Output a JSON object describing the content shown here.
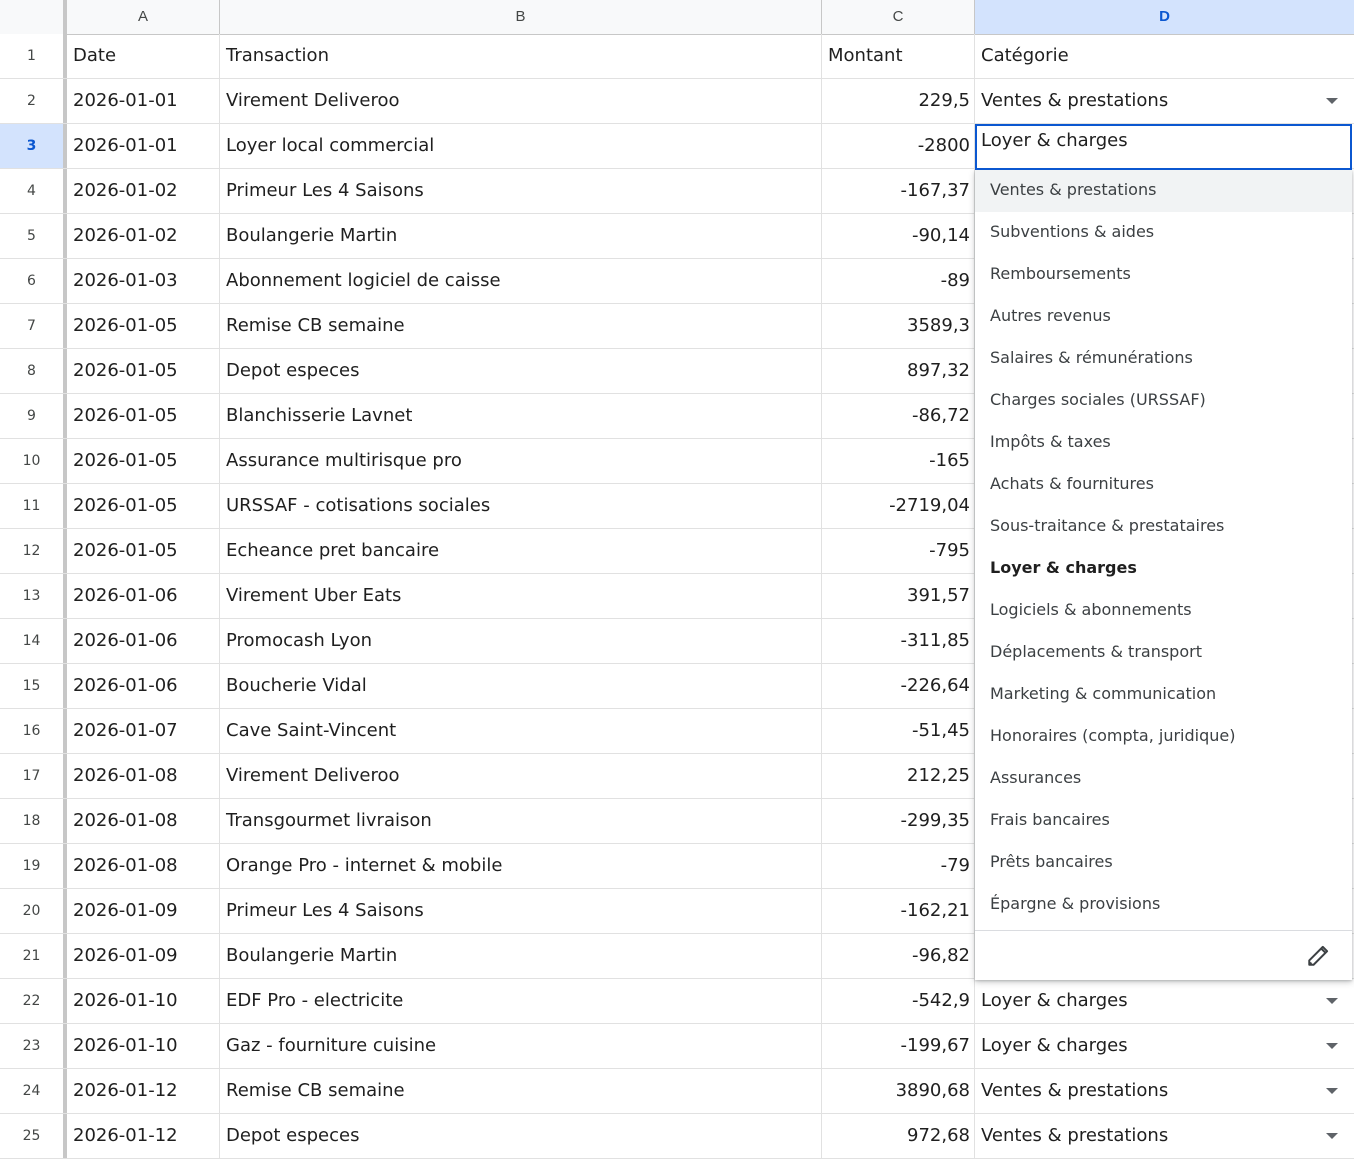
{
  "columns": [
    "A",
    "B",
    "C",
    "D"
  ],
  "selected_column": "D",
  "selected_row": "3",
  "header": {
    "date": "Date",
    "transaction": "Transaction",
    "montant": "Montant",
    "categorie": "Catégorie"
  },
  "rows": [
    {
      "n": "2",
      "date": "2026-01-01",
      "tx": "Virement Deliveroo",
      "amt": "229,5",
      "cat": "Ventes & prestations"
    },
    {
      "n": "3",
      "date": "2026-01-01",
      "tx": "Loyer local commercial",
      "amt": "-2800",
      "cat": ""
    },
    {
      "n": "4",
      "date": "2026-01-02",
      "tx": "Primeur Les 4 Saisons",
      "amt": "-167,37",
      "cat": ""
    },
    {
      "n": "5",
      "date": "2026-01-02",
      "tx": "Boulangerie Martin",
      "amt": "-90,14",
      "cat": ""
    },
    {
      "n": "6",
      "date": "2026-01-03",
      "tx": "Abonnement logiciel de caisse",
      "amt": "-89",
      "cat": ""
    },
    {
      "n": "7",
      "date": "2026-01-05",
      "tx": "Remise CB semaine",
      "amt": "3589,3",
      "cat": ""
    },
    {
      "n": "8",
      "date": "2026-01-05",
      "tx": "Depot especes",
      "amt": "897,32",
      "cat": ""
    },
    {
      "n": "9",
      "date": "2026-01-05",
      "tx": "Blanchisserie Lavnet",
      "amt": "-86,72",
      "cat": ""
    },
    {
      "n": "10",
      "date": "2026-01-05",
      "tx": "Assurance multirisque pro",
      "amt": "-165",
      "cat": ""
    },
    {
      "n": "11",
      "date": "2026-01-05",
      "tx": "URSSAF - cotisations sociales",
      "amt": "-2719,04",
      "cat": ""
    },
    {
      "n": "12",
      "date": "2026-01-05",
      "tx": "Echeance pret bancaire",
      "amt": "-795",
      "cat": ""
    },
    {
      "n": "13",
      "date": "2026-01-06",
      "tx": "Virement Uber Eats",
      "amt": "391,57",
      "cat": ""
    },
    {
      "n": "14",
      "date": "2026-01-06",
      "tx": "Promocash Lyon",
      "amt": "-311,85",
      "cat": ""
    },
    {
      "n": "15",
      "date": "2026-01-06",
      "tx": "Boucherie Vidal",
      "amt": "-226,64",
      "cat": ""
    },
    {
      "n": "16",
      "date": "2026-01-07",
      "tx": "Cave Saint-Vincent",
      "amt": "-51,45",
      "cat": ""
    },
    {
      "n": "17",
      "date": "2026-01-08",
      "tx": "Virement Deliveroo",
      "amt": "212,25",
      "cat": ""
    },
    {
      "n": "18",
      "date": "2026-01-08",
      "tx": "Transgourmet livraison",
      "amt": "-299,35",
      "cat": ""
    },
    {
      "n": "19",
      "date": "2026-01-08",
      "tx": "Orange Pro - internet & mobile",
      "amt": "-79",
      "cat": ""
    },
    {
      "n": "20",
      "date": "2026-01-09",
      "tx": "Primeur Les 4 Saisons",
      "amt": "-162,21",
      "cat": ""
    },
    {
      "n": "21",
      "date": "2026-01-09",
      "tx": "Boulangerie Martin",
      "amt": "-96,82",
      "cat": ""
    },
    {
      "n": "22",
      "date": "2026-01-10",
      "tx": "EDF Pro - electricite",
      "amt": "-542,9",
      "cat": "Loyer & charges"
    },
    {
      "n": "23",
      "date": "2026-01-10",
      "tx": "Gaz - fourniture cuisine",
      "amt": "-199,67",
      "cat": "Loyer & charges"
    },
    {
      "n": "24",
      "date": "2026-01-12",
      "tx": "Remise CB semaine",
      "amt": "3890,68",
      "cat": "Ventes & prestations"
    },
    {
      "n": "25",
      "date": "2026-01-12",
      "tx": "Depot especes",
      "amt": "972,68",
      "cat": "Ventes & prestations"
    }
  ],
  "editor": {
    "value": "Loyer & charges"
  },
  "dropdown": {
    "options": [
      "Ventes & prestations",
      "Subventions & aides",
      "Remboursements",
      "Autres revenus",
      "Salaires & rémunérations",
      "Charges sociales (URSSAF)",
      "Impôts & taxes",
      "Achats & fournitures",
      "Sous-traitance & prestataires",
      "Loyer & charges",
      "Logiciels & abonnements",
      "Déplacements & transport",
      "Marketing & communication",
      "Honoraires (compta, juridique)",
      "Assurances",
      "Frais bancaires",
      "Prêts bancaires",
      "Épargne & provisions"
    ],
    "hovered": "Ventes & prestations",
    "selected": "Loyer & charges",
    "edit_icon": "pencil-icon"
  }
}
